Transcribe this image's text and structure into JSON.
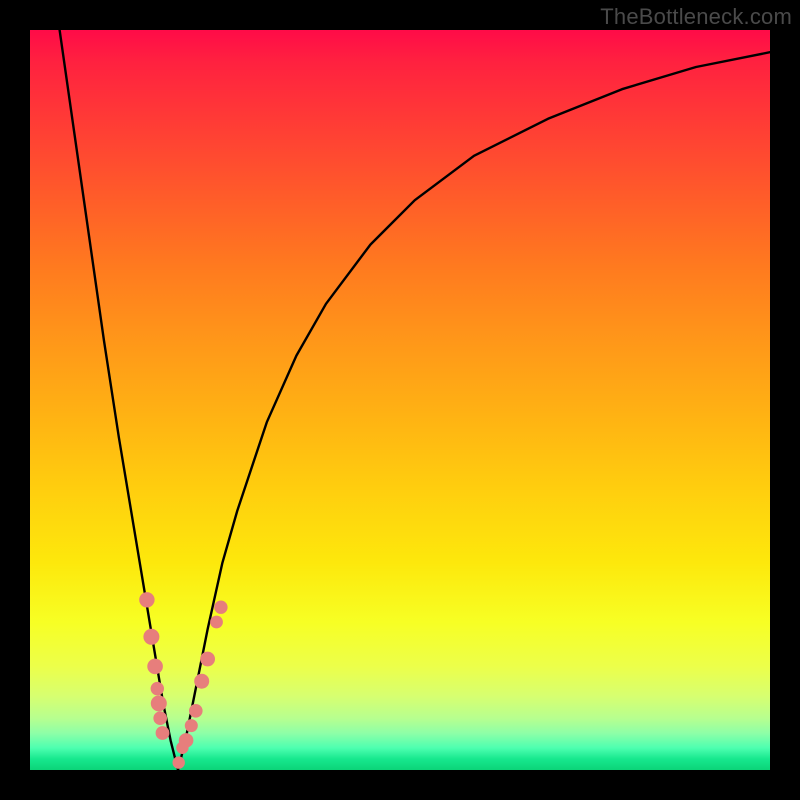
{
  "watermark": "TheBottleneck.com",
  "colors": {
    "frame": "#000000",
    "curve": "#000000",
    "marker": "#e77e7c",
    "gradient_top": "#ff0b48",
    "gradient_bottom": "#0cd478"
  },
  "chart_data": {
    "type": "line",
    "title": "",
    "xlabel": "",
    "ylabel": "",
    "xlim": [
      0,
      100
    ],
    "ylim": [
      0,
      100
    ],
    "grid": false,
    "series": [
      {
        "name": "bottleneck-curve",
        "x": [
          4,
          6,
          8,
          10,
          12,
          14,
          16,
          17,
          18,
          19,
          20,
          21,
          22,
          24,
          26,
          28,
          32,
          36,
          40,
          46,
          52,
          60,
          70,
          80,
          90,
          100
        ],
        "values": [
          100,
          86,
          72,
          58,
          45,
          33,
          21,
          15,
          9,
          4,
          0,
          4,
          9,
          19,
          28,
          35,
          47,
          56,
          63,
          71,
          77,
          83,
          88,
          92,
          95,
          97
        ]
      }
    ],
    "annotations": [
      {
        "type": "marker-cluster",
        "side": "left",
        "x": [
          15.8,
          16.4,
          16.9,
          17.4,
          17.2,
          17.6,
          17.9
        ],
        "y": [
          23,
          18,
          14,
          9,
          11,
          7,
          5
        ]
      },
      {
        "type": "marker-cluster",
        "side": "right",
        "x": [
          20.1,
          20.6,
          21.1,
          21.8,
          22.4,
          23.2,
          24.0,
          25.2,
          25.8
        ],
        "y": [
          1,
          3,
          4,
          6,
          8,
          12,
          15,
          20,
          22
        ]
      }
    ]
  }
}
